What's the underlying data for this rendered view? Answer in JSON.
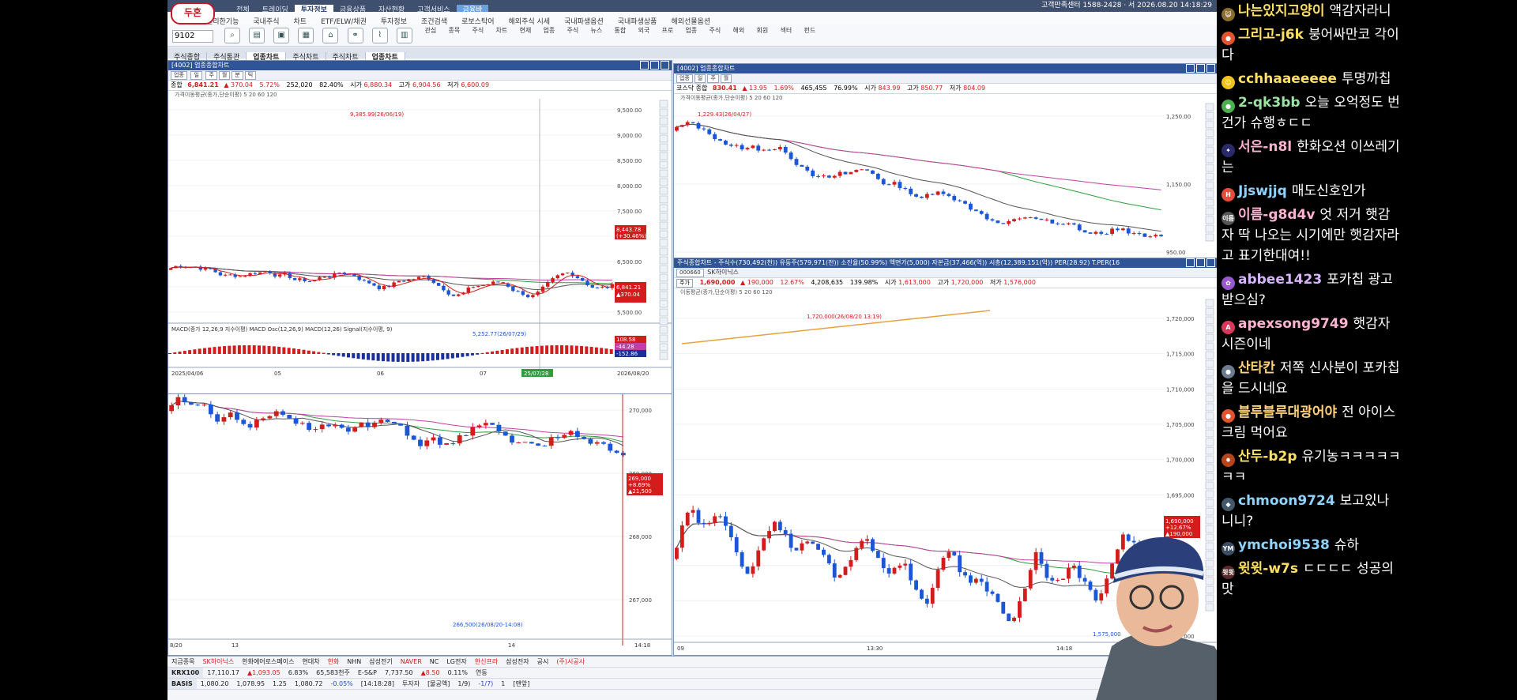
{
  "app": {
    "logo_text": "두혼",
    "top_menu": [
      "전체",
      "트레이딩",
      "투자정보",
      "금융상품",
      "자산현황",
      "고객서비스",
      "금융바"
    ],
    "active_menu": "투자정보",
    "server_info": "고객만족센터 1588-2428 · 서 2026.08.20 14:18:29",
    "sub_menu": [
      "편리한기능",
      "국내주식",
      "차트",
      "ETF/ELW/채권",
      "투자정보",
      "조건검색",
      "로보스탁어",
      "해외주식 시세",
      "국내파생옵션",
      "국내파생상품",
      "해외선물옵션"
    ],
    "stock_code": "9102",
    "toolbar_labels": [
      "관심",
      "종목",
      "주식",
      "차트",
      "현재",
      "업종",
      "주식",
      "뉴스",
      "통합",
      "외국",
      "프로",
      "업종",
      "주식",
      "해외",
      "회원",
      "섹터",
      "펀드"
    ],
    "window_tabs": [
      "주식종합",
      "주식통관",
      "업종차트",
      "주식차트",
      "주식차트",
      "업종차트"
    ],
    "active_window_tab": "업종차트"
  },
  "win1": {
    "title": "[4002] 업종종합차트",
    "period": "일",
    "quote_label": "종합",
    "price": "6,841.21",
    "change": "▲ 370.04",
    "pct": "5.72%",
    "vol": "252,020",
    "ratio": "82.40%",
    "open_label": "시가",
    "open": "6,880.34",
    "high_label": "고가",
    "high": "6,904.56",
    "low_label": "저가",
    "low": "6,600.09",
    "indicator": "가격이동평균(종가,단순이평) 5 20 60 120",
    "high_mark": "9,385.99(26/06/19)",
    "low_mark": "5,252.77(26/07/29)",
    "last_tag": "8,443.78",
    "last_tag_pct": "(+30.46%)",
    "price_tag": "6,841.21",
    "price_tag_change": "▲370.04",
    "y_labels": [
      "9,500.00",
      "9,000.00",
      "8,500.00",
      "8,000.00",
      "7,500.00",
      "7,000.00",
      "6,500.00",
      "6,000.00",
      "5,500.00"
    ],
    "macd_label": "MACD(종가 12,26,9 지수이평)  MACD Osc(12,26,9)  MACD(12,26) Signal(지수이평, 9)",
    "macd_tags": [
      "108.58",
      "-44.28",
      "-152.86"
    ],
    "x_labels": [
      "2025/04/06",
      "05",
      "06",
      "07"
    ],
    "x_cursor": "25/07/28",
    "x_end": "2026/08/20"
  },
  "win2": {
    "title": "[4002] 업종종합차트",
    "quote_label": "코스닥 종합",
    "price": "830.41",
    "change": "▲ 13.95",
    "pct": "1.69%",
    "vol": "465,455",
    "ratio": "76.99%",
    "open_label": "시가",
    "open": "843.99",
    "high_label": "고가",
    "high": "850.77",
    "low_label": "저가",
    "low": "804.09",
    "indicator": "가격이동평균(종가,단순이평) 5 20 60 120",
    "high_mark": "1,229.43(26/04/27)",
    "y_labels": [
      "1,250.00",
      "1,150.00",
      "950.00"
    ],
    "period_text": "코스닥 종합"
  },
  "win3": {
    "title": "주식종합차트 - 주식수(730,492(천))  유동주(579,971(천))  소진율(50.99%)  액면가(5,000)  자본금(37,466(억))  시총(12,389,151(억))  PER(28.92)  T.PER(16",
    "code": "000660",
    "name": "SK하이닉스",
    "price": "1,690,000",
    "change": "▲ 190,000",
    "pct": "12.67%",
    "vol": "4,208,635",
    "ratio": "139.98%",
    "open_label": "시가",
    "open": "1,613,000",
    "high_label": "고가",
    "high": "1,720,000",
    "low_label": "저가",
    "low": "1,576,000",
    "indicator": "이동평균(종가,단순이평) 5 20 60 120",
    "high_mark": "1,720,000(26/08/20 13:19)",
    "low_mark": "1,575,000",
    "y_labels": [
      "1,720,000",
      "1,715,000",
      "1,710,000",
      "1,705,000",
      "1,700,000",
      "1,695,000",
      "1,690,000",
      "1,685,000",
      "1,680,000",
      "1,675,000"
    ],
    "price_tag": "1,690,000",
    "price_tag_pct": "+12.67%",
    "price_tag_change": "▲190,000",
    "x_labels": [
      "09",
      "13:30",
      "14:18"
    ]
  },
  "win4": {
    "y_labels": [
      "270,000",
      "269,000",
      "268,000",
      "267,000"
    ],
    "price_tag": "269,000",
    "price_tag_pct": "+8.69%",
    "price_tag_change": "▲21,500",
    "low_mark": "266,500(26/08/20-14:08)",
    "x_labels": [
      "8/20",
      "13",
      "14",
      "14:18"
    ]
  },
  "ticker": {
    "row1": [
      "지금종목",
      "SK하이닉스",
      "한화에어로스페이스",
      "현대차",
      "한화",
      "NHN",
      "삼성전기",
      "NAVER",
      "NC",
      "LG전자",
      "한신프라",
      "삼성전자",
      "공시",
      "(주)시공사"
    ],
    "row2_label": "KRX100",
    "row2": [
      "17,110.17",
      "▲1,093.05",
      "6.83%",
      "65,583천주",
      "E-S&P",
      "7,737.50",
      "▲8.50",
      "0.11%",
      "연동"
    ],
    "row3_label": "BASIS",
    "row3": [
      "1,080.20",
      "1,078.95",
      "1.25",
      "1,080.72",
      "-0.05%",
      "[14:18:28]",
      "투자자",
      "[물공액]",
      "1/9)",
      "-1/7)",
      "1",
      "[맨앞]"
    ]
  },
  "chat": [
    {
      "nick": "나는있지고양이",
      "text": "액감자라니",
      "color": "#ffe066",
      "av": "#8a6d2f",
      "av_text": "😺"
    },
    {
      "nick": "그리고-j6k",
      "text": "붕어싸만코 각이다",
      "color": "#ffe066",
      "av": "#e2542d",
      "av_text": "●"
    },
    {
      "nick": "cchhaaeeeee",
      "text": "투명까칩",
      "color": "#ffe066",
      "av": "#f1c21b",
      "av_text": "☺"
    },
    {
      "nick": "2-qk3bb",
      "text": "오늘 오억정도 번건가 슈행ㅎㄷㄷ",
      "color": "#9be3a1",
      "av": "#4caf50",
      "av_text": "●"
    },
    {
      "nick": "서은-n8l",
      "text": "한화오션 이쓰레기는",
      "color": "#ffb3d1",
      "av": "#2a2a6a",
      "av_text": "✦"
    },
    {
      "nick": "Jjswjjq",
      "text": "매도신호인가",
      "color": "#8fd3ff",
      "av": "#e34d3a",
      "av_text": "H"
    },
    {
      "nick": "이름-g8d4v",
      "text": "엇 저거 햇감자 딱 나오는 시기에만 햇감자라고 표기한대여!!",
      "color": "#ffb3d1",
      "av": "#555",
      "av_text": "이름"
    },
    {
      "nick": "abbee1423",
      "text": "포카칩 광고받으심?",
      "color": "#d7b6ff",
      "av": "#9b59d0",
      "av_text": "✿"
    },
    {
      "nick": "apexsong9749",
      "text": "햇감자 시즌이네",
      "color": "#ffb3d1",
      "av": "#d63a5a",
      "av_text": "A"
    },
    {
      "nick": "산타칸",
      "text": "저쪽 신사분이 포카칩을 드시네요",
      "color": "#ffd27a",
      "av": "#6d7b90",
      "av_text": "●"
    },
    {
      "nick": "블루블루대광어야",
      "text": "전 아이스크림 먹어요",
      "color": "#ffd27a",
      "av": "#e2542d",
      "av_text": "●"
    },
    {
      "nick": "산두-b2p",
      "text": "유기농ㅋㅋㅋㅋㅋㅋㅋ",
      "color": "#ffe066",
      "av": "#b5451b",
      "av_text": "✹"
    },
    {
      "nick": "chmoon9724",
      "text": "보고있나 니니?",
      "color": "#8fd3ff",
      "av": "#45586b",
      "av_text": "◆"
    },
    {
      "nick": "ymchoi9538",
      "text": "슈하",
      "color": "#8fd3ff",
      "av": "#3d4e62",
      "av_text": "YM"
    },
    {
      "nick": "윗윗-w7s",
      "text": "ㄷㄷㄷㄷ 성공의맛",
      "color": "#ffe066",
      "av": "#5a2a2a",
      "av_text": "윗윗"
    }
  ]
}
